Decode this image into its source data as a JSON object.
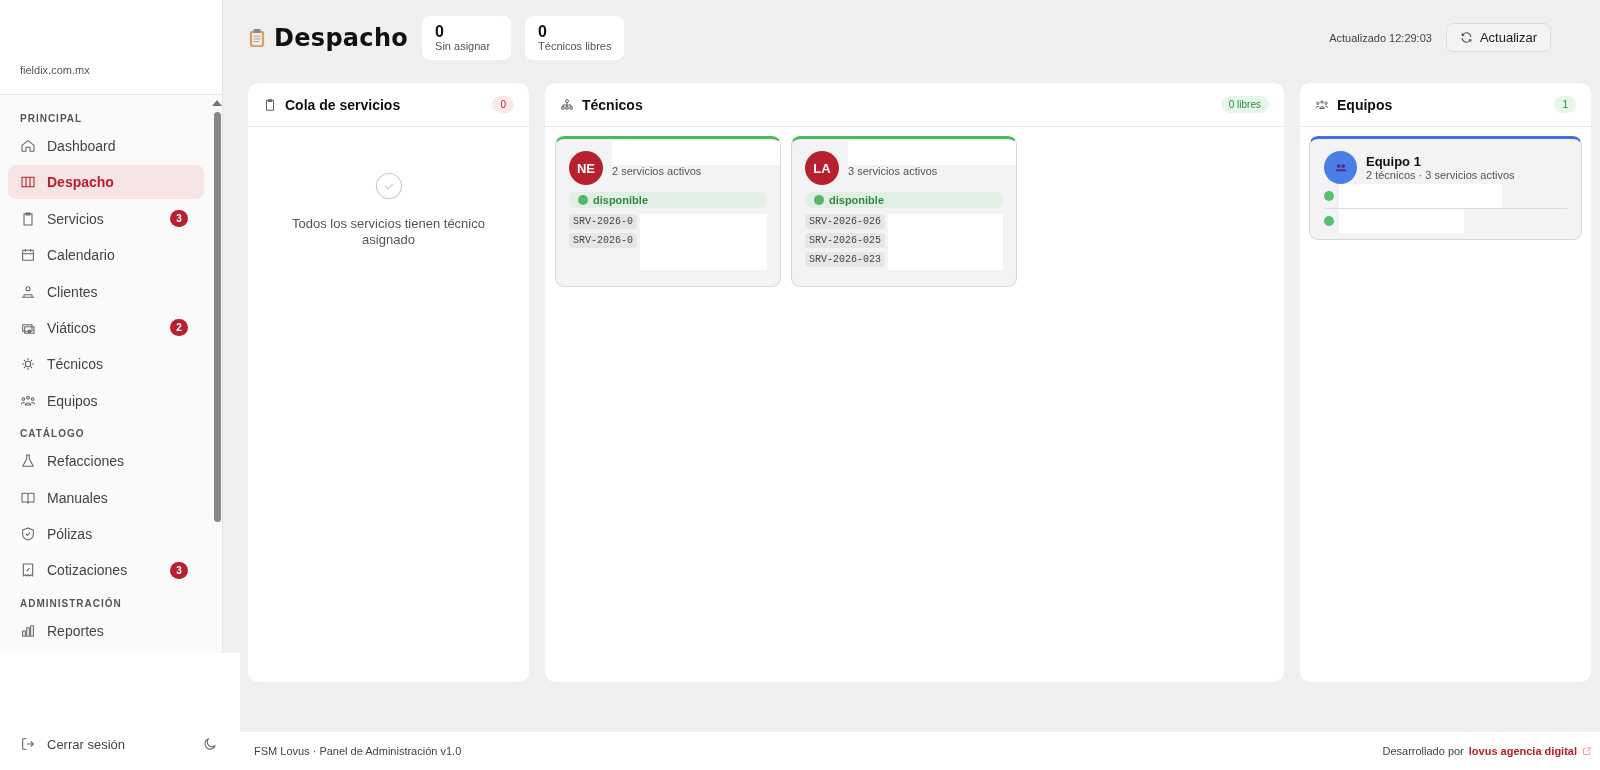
{
  "sidebar": {
    "domain": "fieldix.com.mx",
    "sections": [
      {
        "title": "PRINCIPAL",
        "items": [
          {
            "label": "Dashboard",
            "selected": false
          },
          {
            "label": "Despacho",
            "selected": true
          },
          {
            "label": "Servicios",
            "selected": false,
            "badge": "3"
          },
          {
            "label": "Calendario",
            "selected": false
          },
          {
            "label": "Clientes",
            "selected": false
          },
          {
            "label": "Viáticos",
            "selected": false,
            "badge": "2"
          },
          {
            "label": "Técnicos",
            "selected": false
          },
          {
            "label": "Equipos",
            "selected": false
          }
        ]
      },
      {
        "title": "CATÁLOGO",
        "items": [
          {
            "label": "Refacciones",
            "selected": false
          },
          {
            "label": "Manuales",
            "selected": false
          },
          {
            "label": "Pólizas",
            "selected": false
          },
          {
            "label": "Cotizaciones",
            "selected": false,
            "badge": "3"
          }
        ]
      },
      {
        "title": "ADMINISTRACIÓN",
        "items": [
          {
            "label": "Reportes",
            "selected": false
          }
        ]
      }
    ],
    "logout": "Cerrar sesión"
  },
  "header": {
    "title": "Despacho",
    "stats": [
      {
        "value": "0",
        "label": "Sin asignar"
      },
      {
        "value": "0",
        "label": "Técnicos libres"
      }
    ],
    "updated": "Actualizado 12:29:03",
    "refresh_button": "Actualizar"
  },
  "queue": {
    "title": "Cola de servicios",
    "count": "0",
    "empty_message": "Todos los servicios tienen técnico asignado"
  },
  "technicians": {
    "title": "Técnicos",
    "count": "0 libres",
    "cards": [
      {
        "initials": "NE",
        "services_text": "2 servicios activos",
        "status": "disponible",
        "services": [
          "SRV-2026-0",
          "SRV-2026-0"
        ]
      },
      {
        "initials": "LA",
        "services_text": "3 servicios activos",
        "status": "disponible",
        "services": [
          "SRV-2026-026",
          "SRV-2026-025",
          "SRV-2026-023"
        ]
      }
    ]
  },
  "teams": {
    "title": "Equipos",
    "count": "1",
    "cards": [
      {
        "name": "Equipo 1",
        "meta": "2 técnicos · 3 servicios activos",
        "members": [
          {
            "online": true
          },
          {
            "online": true
          }
        ]
      }
    ]
  },
  "footer": {
    "left": "FSM Lovus · Panel de Administración v1.0",
    "credit": "Desarrollado por",
    "link": "lovus agencia digital"
  }
}
